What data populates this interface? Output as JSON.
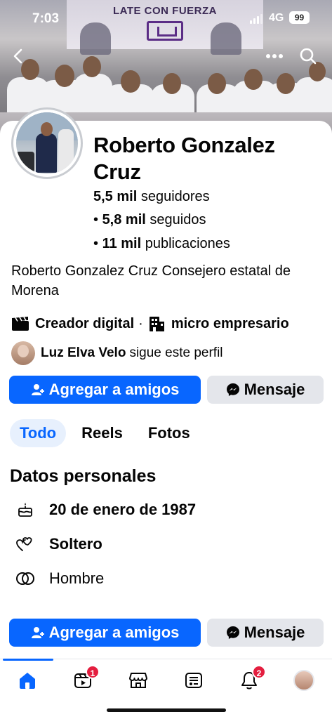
{
  "status_bar": {
    "time": "7:03",
    "network": "4G",
    "battery": "99"
  },
  "cover": {
    "banner_text": "LATE CON FUERZA"
  },
  "header_icons": {
    "back": "chevron-left-icon",
    "more": "more-dots-icon",
    "search": "search-icon"
  },
  "profile": {
    "name": "Roberto Gonzalez Cruz",
    "stats": [
      {
        "bullet": "",
        "value": "5,5 mil",
        "label": "seguidores"
      },
      {
        "bullet": "• ",
        "value": "5,8 mil",
        "label": "seguidos"
      },
      {
        "bullet": "• ",
        "value": "11 mil",
        "label": "publicaciones"
      }
    ],
    "bio": "Roberto Gonzalez Cruz Consejero estatal de Morena",
    "categories": [
      {
        "icon": "clapperboard-icon",
        "label": "Creador digital"
      },
      {
        "icon": "building-icon",
        "label": "micro empresario"
      }
    ],
    "category_separator": "·",
    "followed_by": {
      "name": "Luz Elva Velo",
      "text": "sigue este perfil"
    }
  },
  "actions": {
    "add_friend": "Agregar a amigos",
    "message": "Mensaje"
  },
  "tabs": [
    {
      "label": "Todo",
      "active": true
    },
    {
      "label": "Reels",
      "active": false
    },
    {
      "label": "Fotos",
      "active": false
    }
  ],
  "personal": {
    "title": "Datos personales",
    "rows": [
      {
        "icon": "cake-icon",
        "text": "20 de enero de 1987",
        "bold": true
      },
      {
        "icon": "hearts-icon",
        "text": "Soltero",
        "bold": true
      },
      {
        "icon": "gender-rings-icon",
        "text": "Hombre",
        "bold": false
      }
    ]
  },
  "bottom_nav": {
    "items": [
      {
        "name": "home-icon",
        "badge": ""
      },
      {
        "name": "video-icon",
        "badge": "1"
      },
      {
        "name": "marketplace-icon",
        "badge": ""
      },
      {
        "name": "feeds-icon",
        "badge": ""
      },
      {
        "name": "bell-icon",
        "badge": "2"
      },
      {
        "name": "profile-avatar",
        "badge": ""
      }
    ]
  },
  "colors": {
    "brand_blue": "#0866ff",
    "badge_red": "#e41e3f",
    "secondary_button": "#e4e6eb"
  }
}
